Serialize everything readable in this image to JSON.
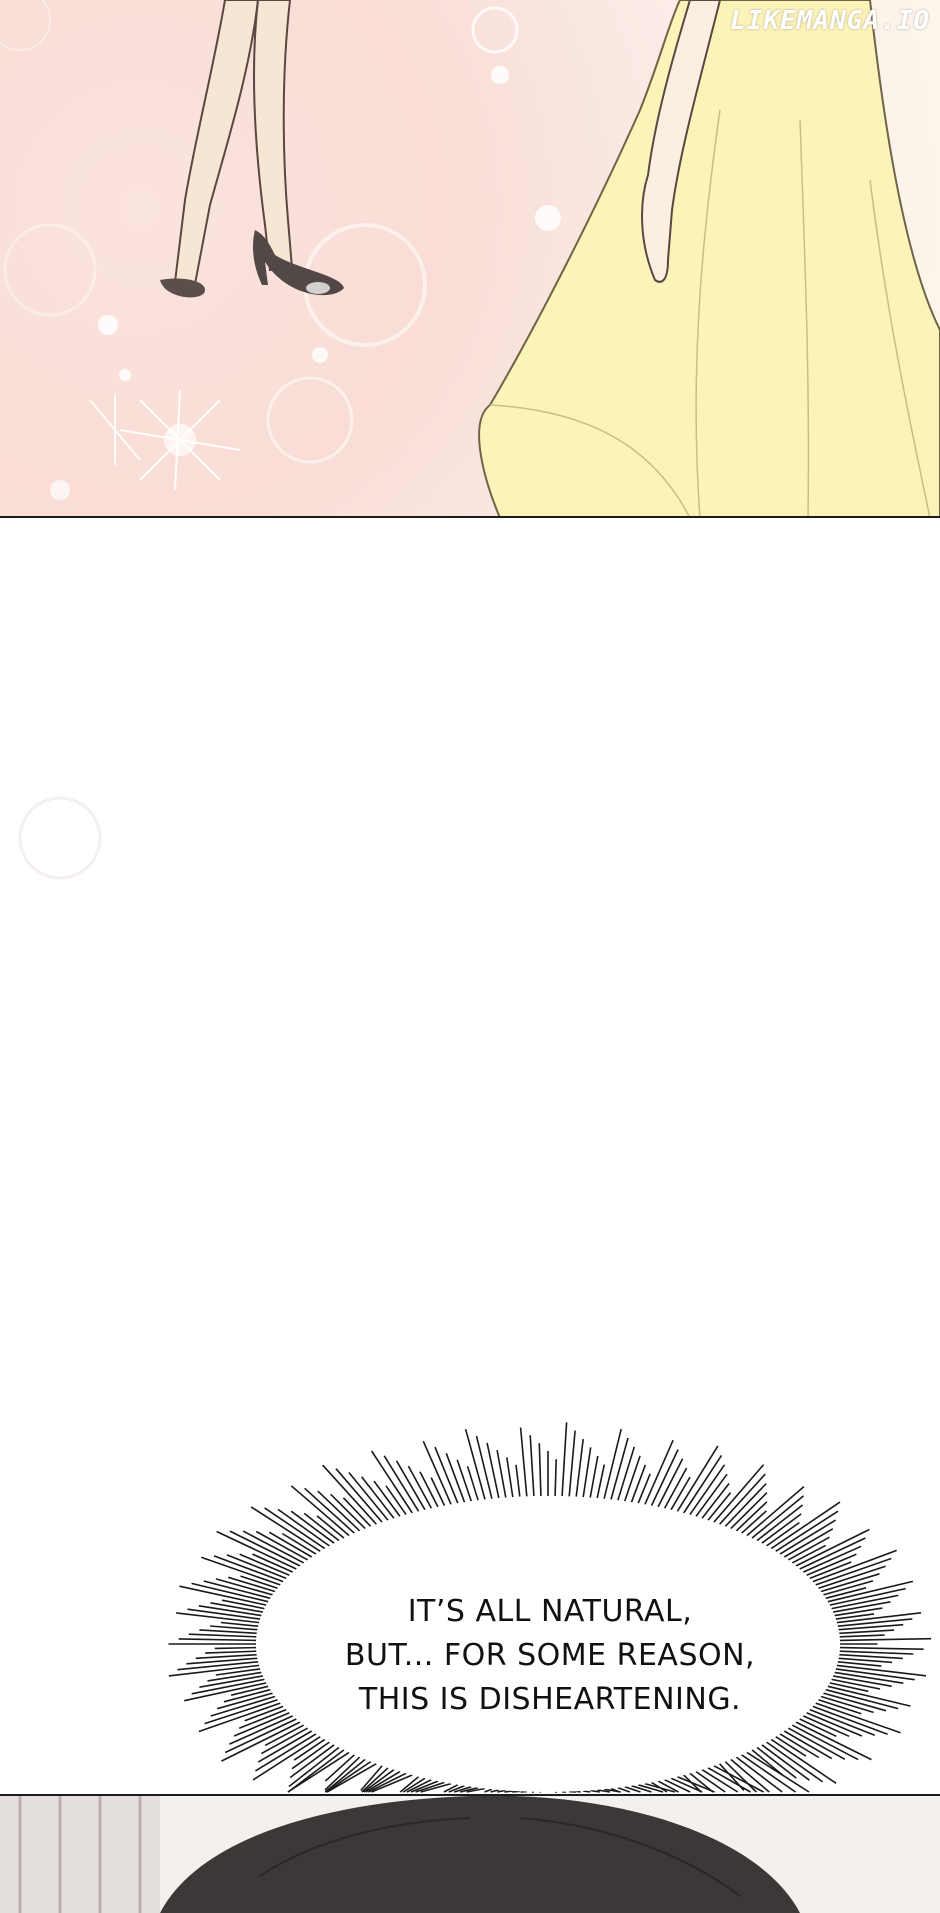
{
  "watermark": "LIKEMANGA.IO",
  "speech_bubble": {
    "lines": [
      "IT’S ALL NATURAL,",
      "BUT... FOR SOME REASON,",
      "THIS IS DISHEARTENING."
    ]
  },
  "colors": {
    "top_panel_bg": "#fbe3df",
    "dress_yellow": "#fbf3b8",
    "shoe_dark": "#5a4f4b",
    "panel_border": "#1c1c1c"
  }
}
